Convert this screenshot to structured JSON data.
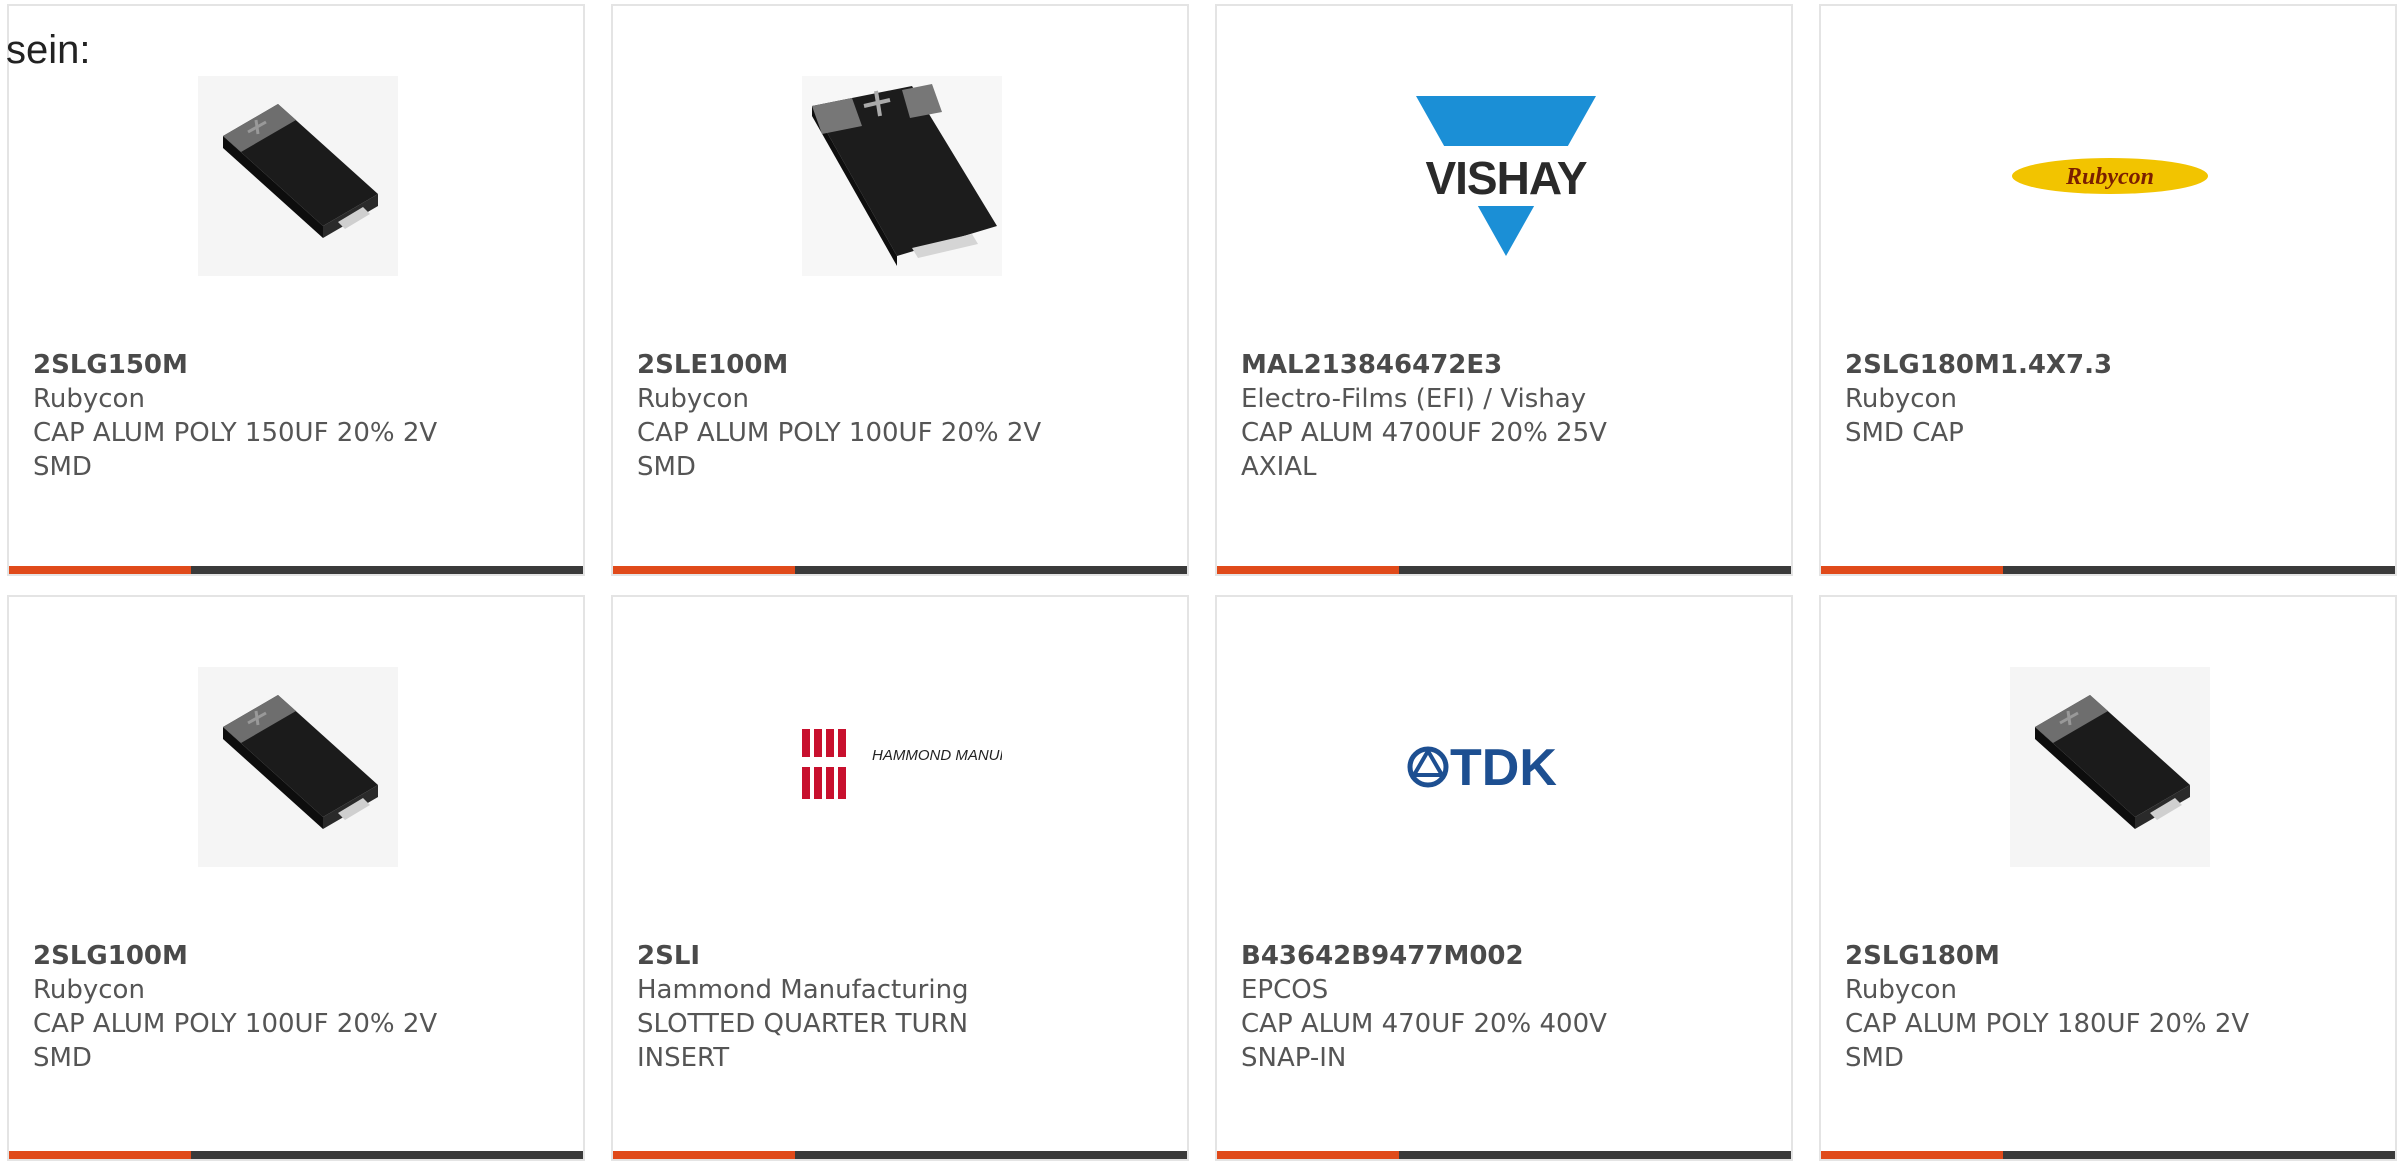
{
  "intro_text": "sein:",
  "colors": {
    "accent": "#e04a1a",
    "bar": "#3a3a3a",
    "border": "#e4e4e4",
    "text": "#555555"
  },
  "products": [
    {
      "part_number": "2SLG150M",
      "manufacturer": "Rubycon",
      "description": "CAP ALUM POLY 150UF 20% 2V\nSMD",
      "image": "smd-capacitor-icon"
    },
    {
      "part_number": "2SLE100M",
      "manufacturer": "Rubycon",
      "description": "CAP ALUM POLY 100UF 20% 2V\nSMD",
      "image": "smd-capacitor-icon"
    },
    {
      "part_number": "MAL213846472E3",
      "manufacturer": "Electro-Films (EFI) / Vishay",
      "description": "CAP ALUM 4700UF 20% 25V\nAXIAL",
      "image": "vishay-logo",
      "logo_text": "VISHAY"
    },
    {
      "part_number": "2SLG180M1.4X7.3",
      "manufacturer": "Rubycon",
      "description": "SMD CAP",
      "image": "rubycon-logo",
      "logo_text": "Rubycon"
    },
    {
      "part_number": "2SLG100M",
      "manufacturer": "Rubycon",
      "description": "CAP ALUM POLY 100UF 20% 2V\nSMD",
      "image": "smd-capacitor-icon"
    },
    {
      "part_number": "2SLI",
      "manufacturer": "Hammond Manufacturing",
      "description": "SLOTTED QUARTER TURN\nINSERT",
      "image": "hammond-logo",
      "logo_text": "HAMMOND MANUFACTURING"
    },
    {
      "part_number": "B43642B9477M002",
      "manufacturer": "EPCOS",
      "description": "CAP ALUM 470UF 20% 400V\nSNAP-IN",
      "image": "tdk-logo",
      "logo_text": "TDK"
    },
    {
      "part_number": "2SLG180M",
      "manufacturer": "Rubycon",
      "description": "CAP ALUM POLY 180UF 20% 2V\nSMD",
      "image": "smd-capacitor-icon"
    }
  ]
}
